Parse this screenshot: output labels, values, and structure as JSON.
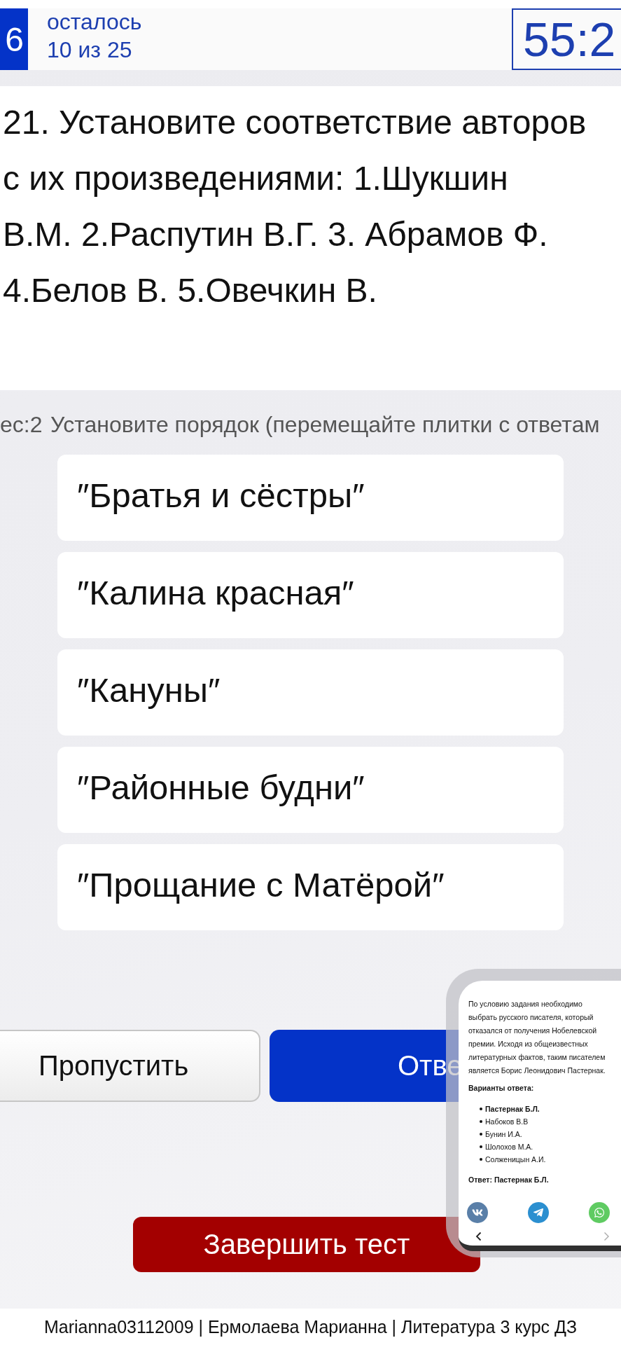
{
  "header": {
    "question_number": "6",
    "remaining_label": "осталось",
    "remaining_count": "10 из 25",
    "timer": "55:2"
  },
  "question": {
    "text": "21. Установите соответствие авторов\nс их произведениями: 1.Шукшин\nВ.М. 2.Распутин В.Г. 3. Абрамов Ф.\n4.Белов В. 5.Овечкин В."
  },
  "task": {
    "weight": "ес:2",
    "instruction": "Установите порядок (перемещайте плитки с ответам"
  },
  "tiles": [
    "″Братья и сёстры″",
    "″Калина красная″",
    "″Кануны″",
    "″Районные будни″",
    "″Прощание с Матёрой″"
  ],
  "actions": [
    {
      "kind": "secondary",
      "label": "Пропустить"
    },
    {
      "kind": "primary",
      "label": "Отве"
    }
  ],
  "finish_button": {
    "label": "Завершить тест"
  },
  "overlay": {
    "explanation": "По условию задания необходимо\nвыбрать русского писателя, который\nотказался от получения Нобелевской\nпремии. Исходя из общеизвестных\nлитературных фактов, таким писателем\nявляется Борис Леонидович Пастернак.",
    "options_heading": "Варианты ответа:",
    "options": [
      {
        "text": "Пастернак Б.Л.",
        "correct": true
      },
      {
        "text": "Набоков В.В",
        "correct": false
      },
      {
        "text": "Бунин И.А.",
        "correct": false
      },
      {
        "text": "Шолохов М.А.",
        "correct": false
      },
      {
        "text": "Солженицын А.И.",
        "correct": false
      }
    ],
    "answer": "Ответ: Пастернак Б.Л.",
    "share": [
      {
        "kind": "vk"
      },
      {
        "kind": "telegram"
      },
      {
        "kind": "whatsapp"
      }
    ]
  },
  "footer": {
    "text": "Marianna03112009 | Ермолаева Марианна | Литература 3 курс ДЗ"
  }
}
